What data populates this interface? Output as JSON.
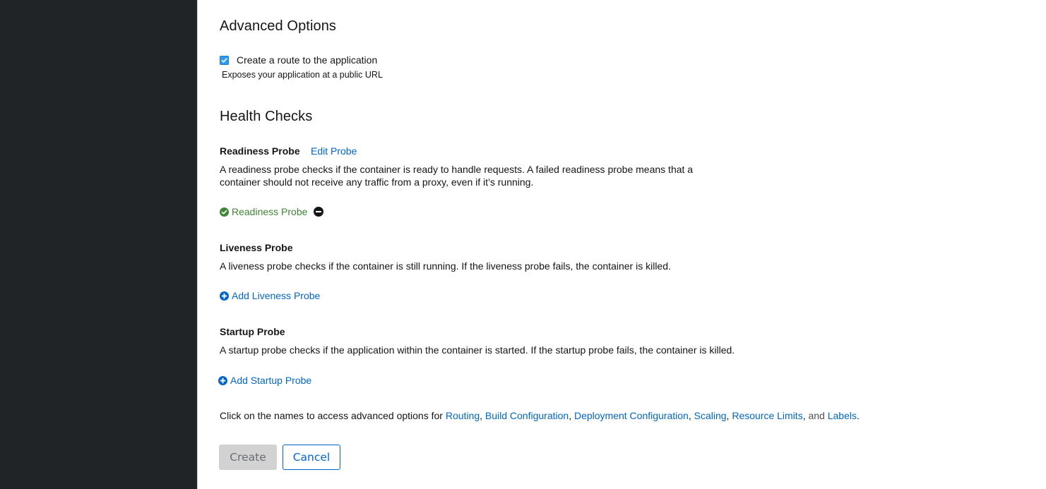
{
  "advanced": {
    "heading": "Advanced Options",
    "route_checkbox": {
      "label": "Create a route to the application",
      "checked": true
    },
    "route_helper": "Exposes your application at a public URL"
  },
  "health": {
    "heading": "Health Checks",
    "readiness": {
      "title": "Readiness Probe",
      "edit_link": "Edit Probe",
      "description_line1": "A readiness probe checks if the container is ready to handle requests. A failed readiness probe means that a",
      "description_line2": "container should not receive any traffic from a proxy, even if it’s running.",
      "status_label": "Readiness Probe"
    },
    "liveness": {
      "title": "Liveness Probe",
      "description": "A liveness probe checks if the container is still running. If the liveness probe fails, the container is killed.",
      "add_link": "Add Liveness Probe"
    },
    "startup": {
      "title": "Startup Probe",
      "description": "A startup probe checks if the application within the container is started. If the startup probe fails, the container is killed.",
      "add_link": "Add Startup Probe"
    }
  },
  "advanced_links": {
    "prefix": "Click on the names to access advanced options for ",
    "routing": "Routing",
    "build_configuration": "Build Configuration",
    "deployment_configuration": "Deployment Configuration",
    "scaling": "Scaling",
    "resource_limits": "Resource Limits",
    "and_text": " and ",
    "labels": "Labels",
    "sep": ", ",
    "sep_last": ",",
    "end": "."
  },
  "actions": {
    "create_label": "Create",
    "cancel_label": "Cancel"
  },
  "colors": {
    "sidebar": "#212427",
    "link": "#0066cc",
    "success": "#3e8635",
    "checkbox": "#2b9af3"
  }
}
